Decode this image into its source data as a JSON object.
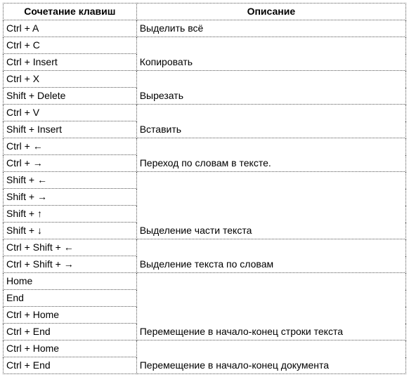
{
  "headers": {
    "shortcut": "Сочетание клавиш",
    "description": "Описание"
  },
  "rows": [
    {
      "shortcut": "Ctrl + A",
      "description": "Выделить всё",
      "span": 1
    },
    {
      "shortcut": "Ctrl + C",
      "description": "Копировать",
      "span": 2
    },
    {
      "shortcut": "Ctrl + Insert"
    },
    {
      "shortcut": "Ctrl + X",
      "description": "Вырезать",
      "span": 2
    },
    {
      "shortcut": "Shift + Delete"
    },
    {
      "shortcut": "Ctrl + V",
      "description": "Вставить",
      "span": 2
    },
    {
      "shortcut": "Shift + Insert"
    },
    {
      "shortcut": "Ctrl + ←",
      "description": "Переход по словам в тексте.",
      "span": 2
    },
    {
      "shortcut": "Ctrl + →"
    },
    {
      "shortcut": "Shift + ←",
      "description": "Выделение части текста",
      "span": 4
    },
    {
      "shortcut": "Shift + →"
    },
    {
      "shortcut": "Shift + ↑"
    },
    {
      "shortcut": "Shift + ↓"
    },
    {
      "shortcut": "Ctrl + Shift + ←",
      "description": "Выделение текста по словам",
      "span": 2
    },
    {
      "shortcut": "Ctrl + Shift + →"
    },
    {
      "shortcut": "Home",
      "description": "Перемещение в начало-конец строки текста",
      "span": 4
    },
    {
      "shortcut": "End"
    },
    {
      "shortcut": "Ctrl + Home"
    },
    {
      "shortcut": "Ctrl + End"
    },
    {
      "shortcut": "Ctrl + Home",
      "description": "Перемещение в начало-конец документа",
      "span": 2
    },
    {
      "shortcut": "Ctrl + End"
    }
  ]
}
